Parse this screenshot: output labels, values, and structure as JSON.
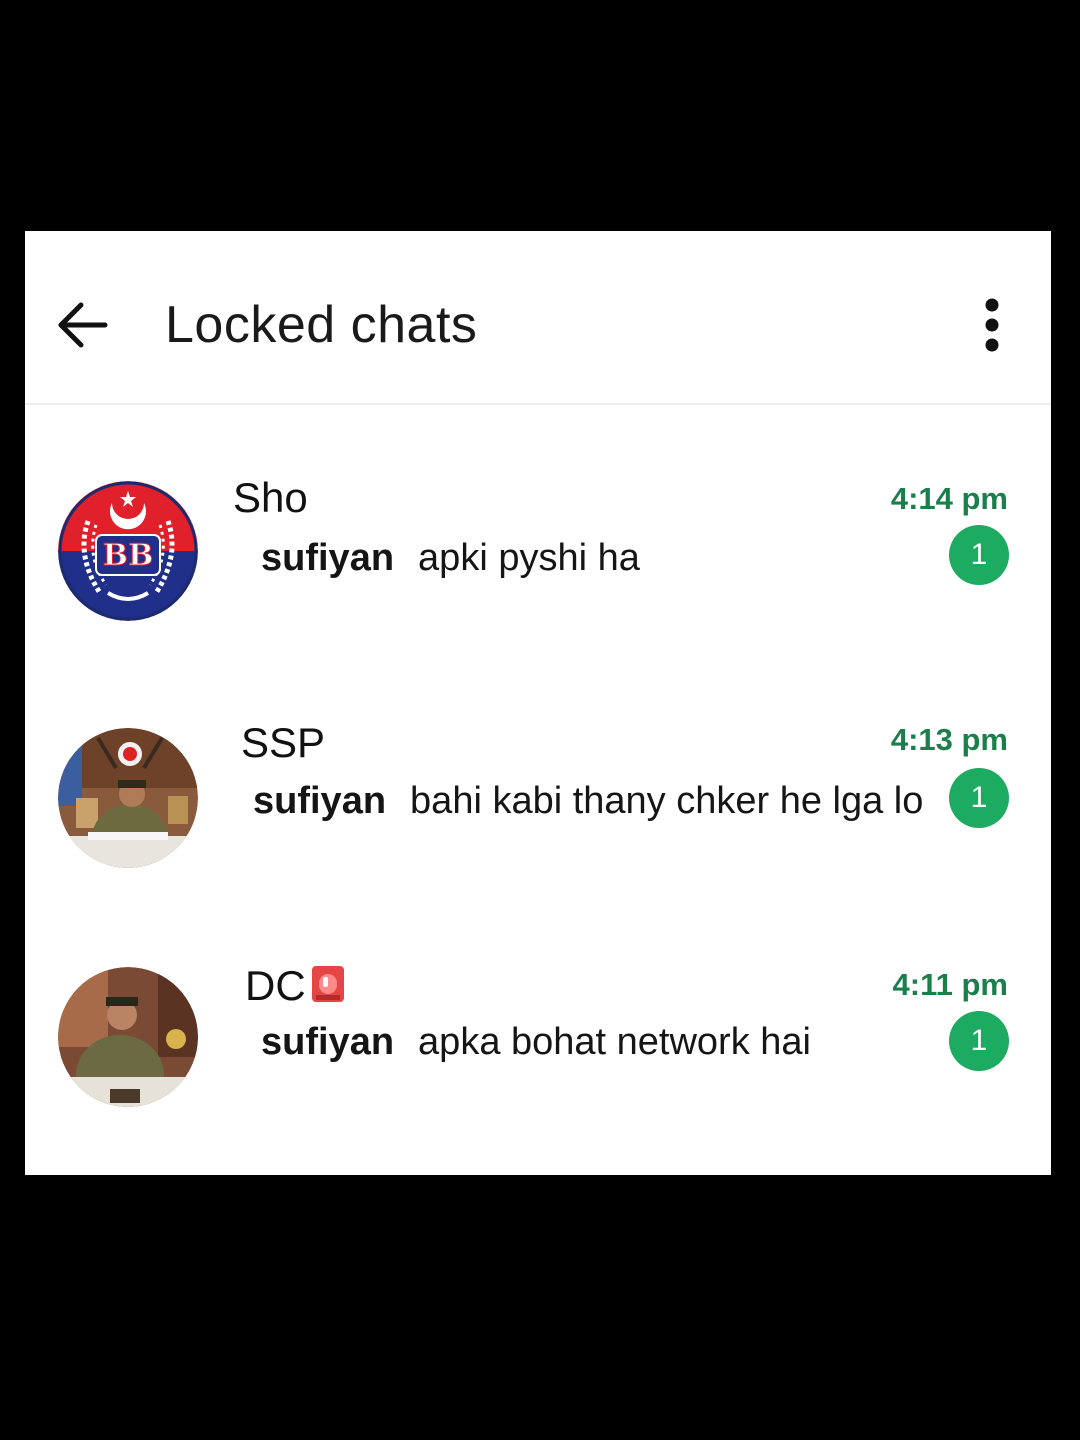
{
  "header": {
    "title": "Locked chats",
    "back_icon": "arrow-left-icon",
    "menu_icon": "more-vertical-icon"
  },
  "chats": [
    {
      "name": "Sho",
      "sender": "sufiyan",
      "message": "apki pyshi ha",
      "time": "4:14 pm",
      "unread": "1",
      "avatar": "police-emblem-avatar"
    },
    {
      "name": "SSP",
      "sender": "sufiyan",
      "message": "bahi kabi thany chker he lga lo",
      "time": "4:13 pm",
      "unread": "1",
      "avatar": "officer-photo-avatar"
    },
    {
      "name": "DC",
      "name_emoji": "siren-icon",
      "sender": "sufiyan",
      "message": "apka bohat network hai",
      "time": "4:11 pm",
      "unread": "1",
      "avatar": "officer-photo-avatar"
    }
  ],
  "colors": {
    "accent_green": "#1daa61",
    "time_green": "#1b7f4c",
    "background": "#ffffff",
    "frame": "#000000"
  }
}
